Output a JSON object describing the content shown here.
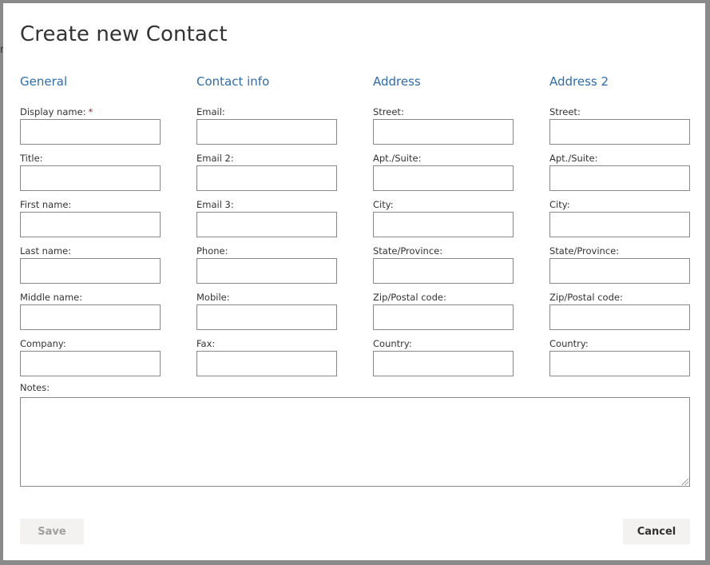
{
  "backdrop": {
    "edge_char": "r"
  },
  "dialog": {
    "title": "Create new Contact",
    "columns": [
      {
        "heading": "General",
        "fields": [
          {
            "label": "Display name:",
            "required": true,
            "value": ""
          },
          {
            "label": "Title:",
            "value": ""
          },
          {
            "label": "First name:",
            "value": ""
          },
          {
            "label": "Last name:",
            "value": ""
          },
          {
            "label": "Middle name:",
            "value": ""
          },
          {
            "label": "Company:",
            "value": ""
          }
        ]
      },
      {
        "heading": "Contact info",
        "fields": [
          {
            "label": "Email:",
            "value": ""
          },
          {
            "label": "Email 2:",
            "value": ""
          },
          {
            "label": "Email 3:",
            "value": ""
          },
          {
            "label": "Phone:",
            "value": ""
          },
          {
            "label": "Mobile:",
            "value": ""
          },
          {
            "label": "Fax:",
            "value": ""
          }
        ]
      },
      {
        "heading": "Address",
        "fields": [
          {
            "label": "Street:",
            "value": ""
          },
          {
            "label": "Apt./Suite:",
            "value": ""
          },
          {
            "label": "City:",
            "value": ""
          },
          {
            "label": "State/Province:",
            "value": ""
          },
          {
            "label": "Zip/Postal code:",
            "value": ""
          },
          {
            "label": "Country:",
            "value": ""
          }
        ]
      },
      {
        "heading": "Address 2",
        "fields": [
          {
            "label": "Street:",
            "value": ""
          },
          {
            "label": "Apt./Suite:",
            "value": ""
          },
          {
            "label": "City:",
            "value": ""
          },
          {
            "label": "State/Province:",
            "value": ""
          },
          {
            "label": "Zip/Postal code:",
            "value": ""
          },
          {
            "label": "Country:",
            "value": ""
          }
        ]
      }
    ],
    "required_marker": "*",
    "notes": {
      "label": "Notes:",
      "value": ""
    },
    "buttons": {
      "save": "Save",
      "cancel": "Cancel"
    }
  },
  "colors": {
    "heading": "#2f6ca8",
    "required": "#a4262c",
    "button_bg": "#f3f2f1",
    "save_disabled_text": "#a19f9d"
  }
}
